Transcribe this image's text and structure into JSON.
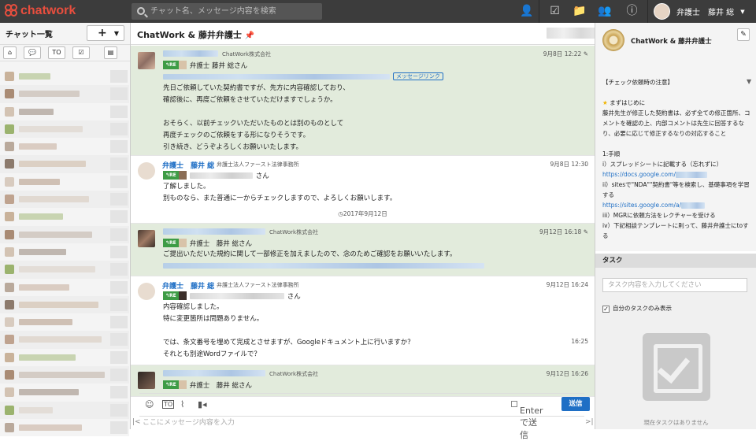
{
  "app": {
    "name": "chatwork"
  },
  "search": {
    "placeholder": "チャット名、メッセージ内容を検索"
  },
  "topbar": {
    "icons": [
      "contacts-icon",
      "tasks-icon",
      "files-icon",
      "add-contact-icon",
      "info-icon"
    ]
  },
  "user": {
    "name": "弁護士　藤井 総"
  },
  "sidebar": {
    "title": "チャット一覧",
    "add_label": "+",
    "filters": [
      "home",
      "chat",
      "TO",
      "task",
      "group"
    ]
  },
  "room": {
    "title": "ChatWork & 藤井弁護士",
    "task_button": "✔",
    "files_button": "📁",
    "settings_button": "⚙"
  },
  "messages": [
    {
      "id": "m1",
      "self": true,
      "org": "ChatWork株式会社",
      "time": "9月8日 12:22",
      "re_name": "弁護士 藤井 総さん",
      "link_label": "メッセージリンク",
      "lines": [
        "先日ご依頼していた契約書ですが、先方に内容確認しており、",
        "確認後に、再度ご依頼をさせていただけますでしょうか。",
        "",
        "おそらく、以前チェックいただいたものとは別のものとして",
        "再度チェックのご依頼をする形になりそうです。",
        "引き続き、どうぞよろしくお願いいたします。"
      ]
    },
    {
      "id": "m2",
      "self": false,
      "name": "弁護士　藤井 総",
      "org": "弁護士法人ファースト法律事務所",
      "time": "9月8日 12:30",
      "re_suffix": "さん",
      "lines": [
        "了解しました。",
        "別ものなら、また普通に一からチェックしますので、よろしくお願いします。"
      ]
    },
    {
      "id": "m3",
      "self": true,
      "org": "ChatWork株式会社",
      "time": "9月12日 16:18",
      "re_name": "弁護士　藤井 総さん",
      "lines": [
        "ご提出いただいた規約に関して一部修正を加えましたので、念のためご確認をお願いいたします。"
      ]
    },
    {
      "id": "m4",
      "self": false,
      "name": "弁護士　藤井 総",
      "org": "弁護士法人ファースト法律事務所",
      "time": "9月12日 16:24",
      "time2": "16:25",
      "re_suffix": "さん",
      "lines": [
        "内容確認しました。",
        "特に変更箇所は問題ありません。",
        "",
        "では、条文番号を埋めて完成とさせますが、Googleドキュメント上に行いますか？",
        "それとも別途Wordファイルで？"
      ]
    },
    {
      "id": "m5",
      "self": true,
      "org": "ChatWork株式会社",
      "time": "9月12日 16:26",
      "re_name": "弁護士　藤井 総さん",
      "lines": []
    }
  ],
  "date_separator": "2017年9月12日",
  "composer": {
    "enter_label": "Enterで送信",
    "send_label": "送信",
    "placeholder": "ここにメッセージ内容を入力"
  },
  "panel": {
    "title": "ChatWork & 藤井弁護士",
    "desc": {
      "heading": "【チェック依頼時の注意】",
      "intro_title": "まずはじめに",
      "intro": "藤井先生が修正した契約書は、必ず全ての修正箇所、コメントを確認の上、内部コメントは先生に回答するなり、必要に応じて修正するなりの対応すること",
      "steps_title": "1:手順",
      "step1": "i）スプレッドシートに記載する（忘れずに）",
      "link1": "https://docs.google.com/",
      "step2": "ii）sitesで\"NDA\"\"契約書\"等を検索し、基礎事項を学習する",
      "link2": "https://sites.google.com/a/",
      "step3": "iii）MGRに依頼方法をレクチャーを受ける",
      "step4": "iv）下記相談テンプレートに則って、藤井弁護士にtoする"
    },
    "task_title": "タスク",
    "task_placeholder": "タスク内容を入力してください",
    "task_own_label": "自分のタスクのみ表示",
    "task_empty": "現在タスクはありません"
  },
  "colors": {
    "accent": "#1f6fc5",
    "self_bg": "#e2ebdc",
    "re_tag": "#3e9c46",
    "logo": "#e84e3e"
  }
}
